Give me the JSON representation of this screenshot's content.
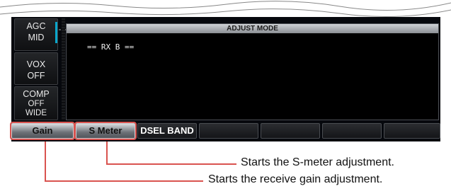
{
  "side_buttons": [
    {
      "line1": "AGC",
      "line2": "MID"
    },
    {
      "line1": "VOX",
      "line2": "OFF"
    },
    {
      "line1": "COMP",
      "line2": "OFF",
      "line3": "WIDE"
    }
  ],
  "panel": {
    "title": "ADJUST MODE",
    "text": "== RX B =="
  },
  "function_keys": [
    "Gain",
    "S Meter",
    "DSEL BAND",
    "",
    "",
    "",
    ""
  ],
  "callouts": {
    "s_meter": "Starts the S-meter adjustment.",
    "gain": "Starts the receive gain adjustment."
  },
  "colors": {
    "accent": "#0aa7cc",
    "highlight": "#d9534f"
  }
}
